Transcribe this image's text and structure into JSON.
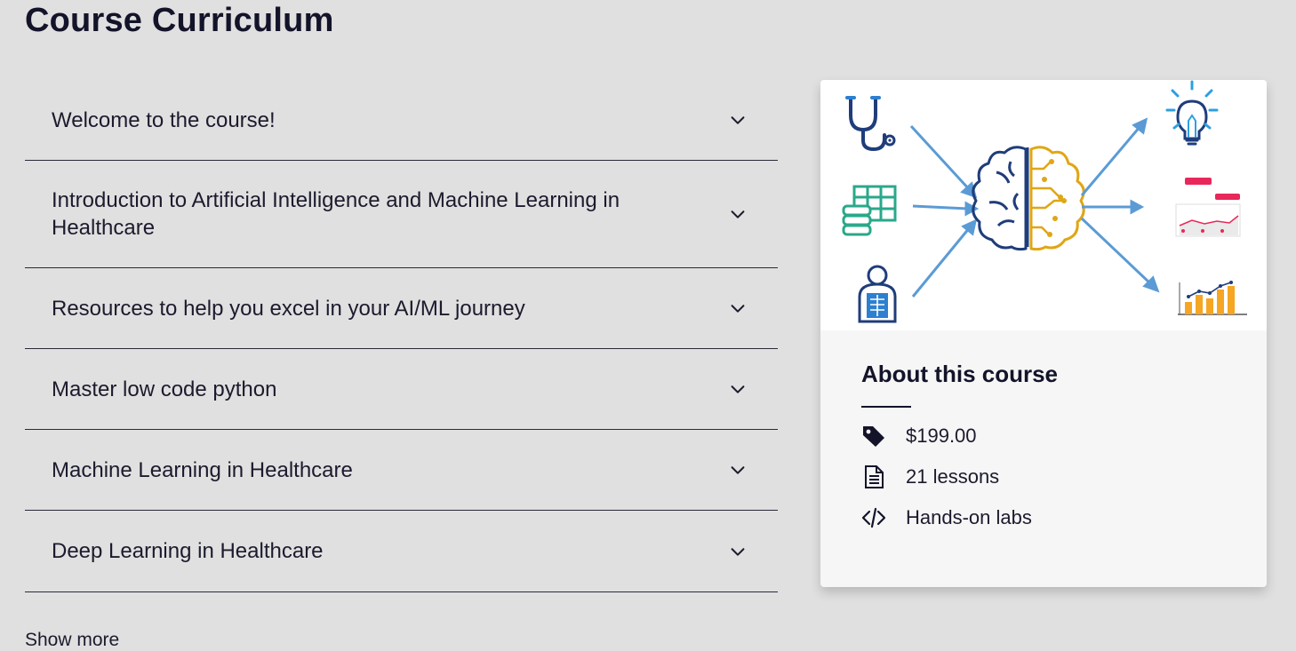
{
  "page": {
    "title": "Course Curriculum",
    "show_more": "Show more"
  },
  "curriculum": {
    "sections": [
      {
        "title": "Welcome to the course!",
        "icon": "chevron-down-icon"
      },
      {
        "title": "Introduction to Artificial Intelligence and Machine Learning in Healthcare",
        "icon": "chevron-down-icon"
      },
      {
        "title": "Resources to help you excel in your AI/ML journey",
        "icon": "chevron-down-icon"
      },
      {
        "title": "Master low code python",
        "icon": "chevron-down-icon"
      },
      {
        "title": "Machine Learning in Healthcare",
        "icon": "chevron-down-icon"
      },
      {
        "title": "Deep Learning in Healthcare",
        "icon": "chevron-down-icon"
      }
    ]
  },
  "about": {
    "title": "About this course",
    "items": [
      {
        "icon": "price-tag-icon",
        "text": "$199.00"
      },
      {
        "icon": "document-icon",
        "text": "21 lessons"
      },
      {
        "icon": "code-icon",
        "text": "Hands-on labs"
      }
    ]
  },
  "colors": {
    "background": "#e0e0e0",
    "title": "#13132a",
    "brain_left": "#1f3d7a",
    "brain_right": "#e0a615",
    "arrows": "#5b9bd5",
    "teal": "#2aa88a",
    "accent_pink": "#e8285a",
    "bars": "#f5a623"
  }
}
